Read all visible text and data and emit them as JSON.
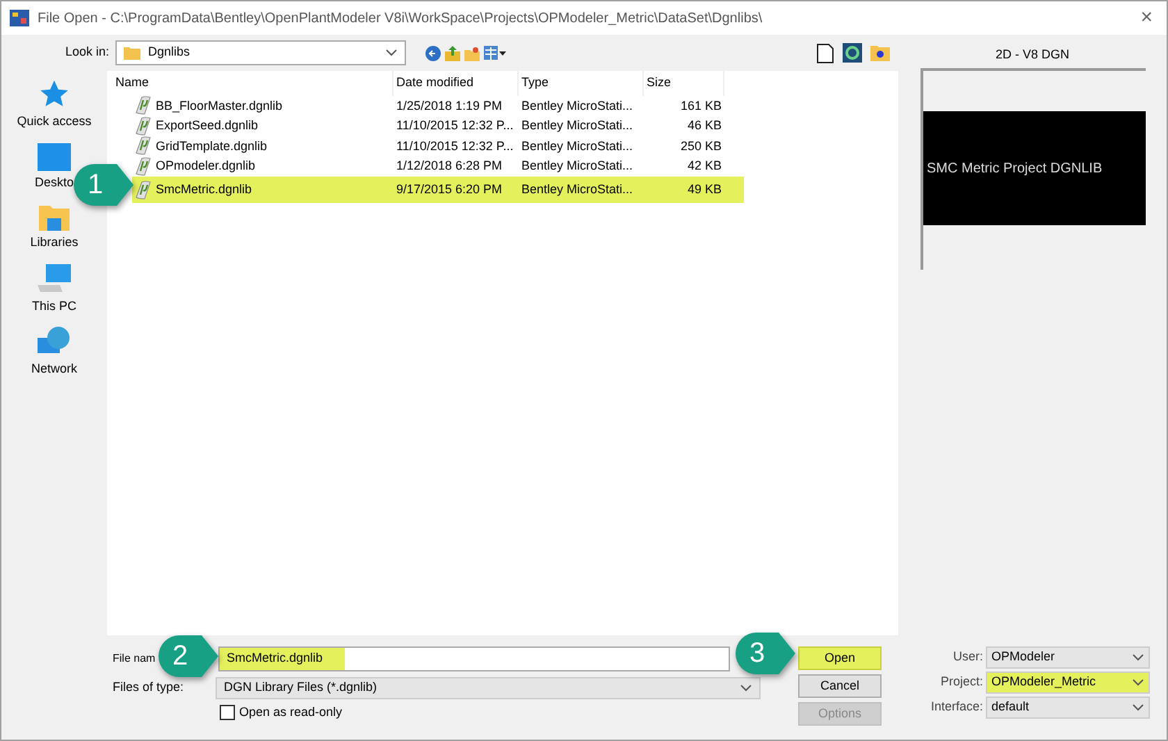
{
  "window": {
    "title": "File Open - C:\\ProgramData\\Bentley\\OpenPlantModeler V8i\\WorkSpace\\Projects\\OPModeler_Metric\\DataSet\\Dgnlibs\\",
    "close": "×"
  },
  "look_in": {
    "label": "Look in:",
    "value": "Dgnlibs"
  },
  "places": [
    {
      "label": "Quick access",
      "kind": "star"
    },
    {
      "label": "Deskto",
      "kind": "desktop"
    },
    {
      "label": "Libraries",
      "kind": "library"
    },
    {
      "label": "This PC",
      "kind": "pc"
    },
    {
      "label": "Network",
      "kind": "network"
    }
  ],
  "table": {
    "columns": [
      "Name",
      "Date modified",
      "Type",
      "Size"
    ],
    "rows": [
      {
        "name": "BB_FloorMaster.dgnlib",
        "date": "1/25/2018 1:19 PM",
        "type": "Bentley MicroStati...",
        "size": "161 KB",
        "highlighted": false
      },
      {
        "name": "ExportSeed.dgnlib",
        "date": "11/10/2015 12:32 P...",
        "type": "Bentley MicroStati...",
        "size": "46 KB",
        "highlighted": false
      },
      {
        "name": "GridTemplate.dgnlib",
        "date": "11/10/2015 12:32 P...",
        "type": "Bentley MicroStati...",
        "size": "250 KB",
        "highlighted": false
      },
      {
        "name": "OPmodeler.dgnlib",
        "date": "1/12/2018 6:28 PM",
        "type": "Bentley MicroStati...",
        "size": "42 KB",
        "highlighted": false
      },
      {
        "name": "SmcMetric.dgnlib",
        "date": "9/17/2015 6:20 PM",
        "type": "Bentley MicroStati...",
        "size": "49 KB",
        "highlighted": true
      }
    ]
  },
  "preview": {
    "label": "2D - V8 DGN",
    "text": "SMC Metric Project DGNLIB"
  },
  "file_name": {
    "label": "File nam",
    "value": "SmcMetric.dgnlib",
    "highlighted": true
  },
  "files_of_type": {
    "label": "Files of type:",
    "value": "DGN Library Files (*.dgnlib)"
  },
  "read_only": {
    "label": "Open as read-only",
    "checked": false
  },
  "buttons": [
    {
      "label": "Open",
      "highlighted": true,
      "disabled": false
    },
    {
      "label": "Cancel",
      "highlighted": false,
      "disabled": false
    },
    {
      "label": "Options",
      "highlighted": false,
      "disabled": true
    }
  ],
  "settings": [
    {
      "label": "User:",
      "value": "OPModeler",
      "highlighted": false
    },
    {
      "label": "Project:",
      "value": "OPModeler_Metric",
      "highlighted": true
    },
    {
      "label": "Interface:",
      "value": "default",
      "highlighted": false
    }
  ],
  "callouts": [
    "1",
    "2",
    "3"
  ]
}
